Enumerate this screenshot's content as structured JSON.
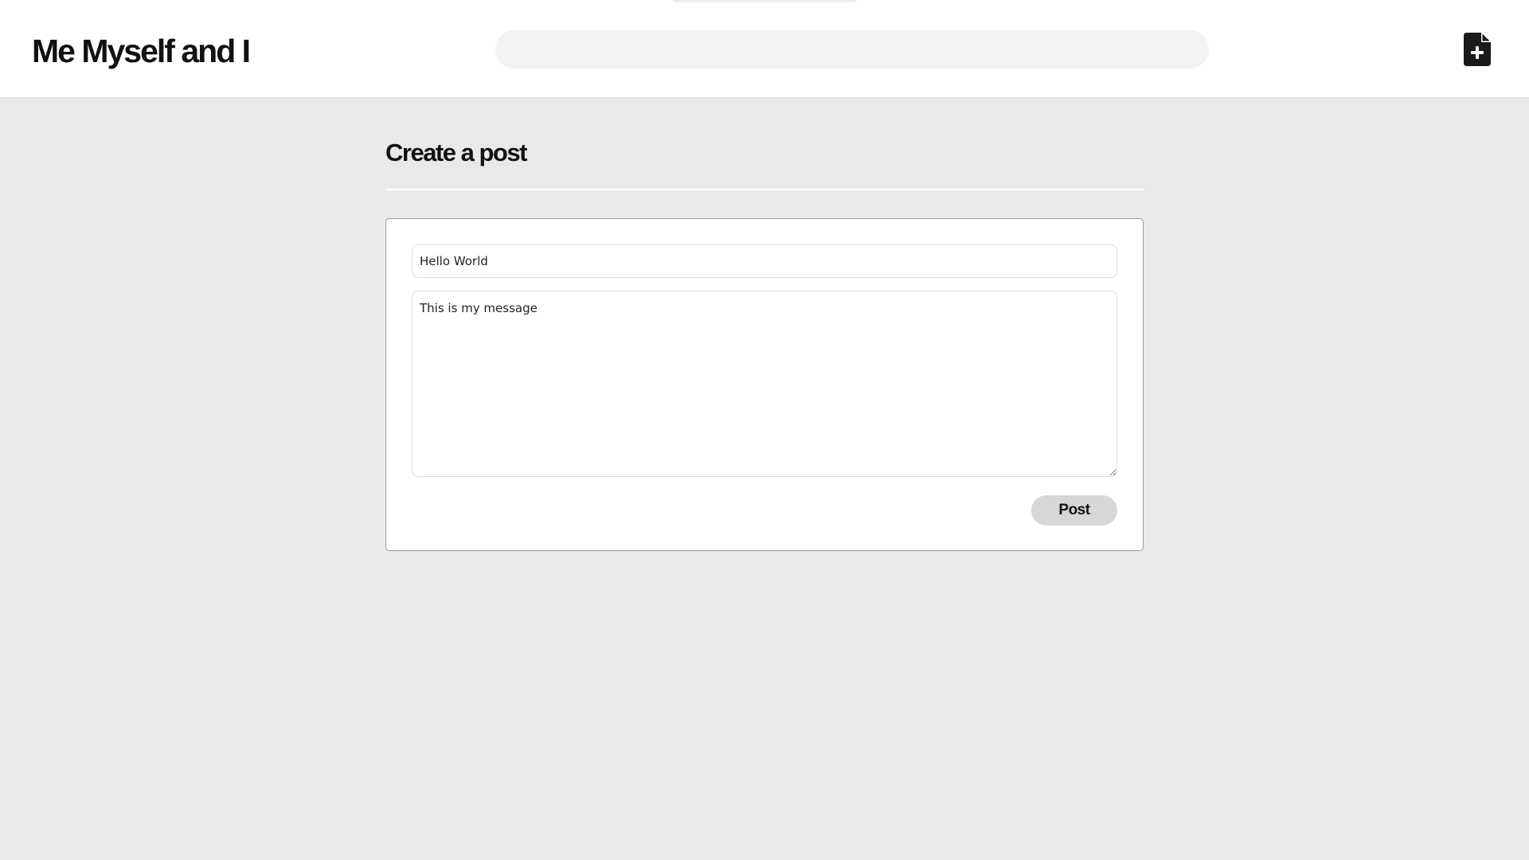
{
  "header": {
    "site_title": "Me Myself and I",
    "search": {
      "value": "",
      "placeholder": ""
    },
    "new_post_icon": "file-plus-icon"
  },
  "main": {
    "page_title": "Create a post",
    "form": {
      "title_value": "Hello World",
      "message_value": "This is my message",
      "submit_label": "Post"
    }
  },
  "colors": {
    "page_background": "#e8e9eb",
    "header_background": "#ffffff",
    "search_background": "#f3f3f3",
    "button_background": "#d7d7d7",
    "text": "#111111"
  }
}
